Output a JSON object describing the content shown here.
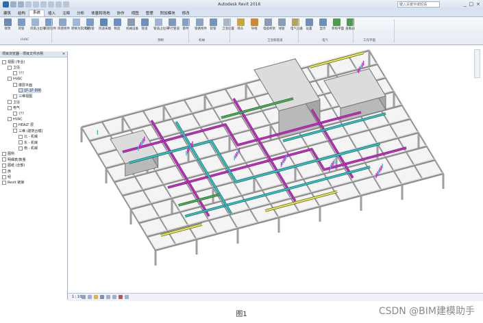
{
  "window": {
    "title": "Autodesk Revit 2016",
    "search_placeholder": "键入关键字或短语"
  },
  "ribbon_tabs": [
    "建筑",
    "结构",
    "系统",
    "插入",
    "注释",
    "分析",
    "体量和场地",
    "协作",
    "视图",
    "管理",
    "附加模块",
    "修改"
  ],
  "active_tab": "系统",
  "ribbon_panels": [
    "HVAC",
    "预制",
    "机械",
    "卫浴和管道",
    "电气",
    "工作平面"
  ],
  "ribbon_tools": [
    {
      "label": "修改",
      "icon": "modify-icon",
      "color": "#6d8ab5"
    },
    {
      "label": "风管",
      "icon": "duct-icon",
      "color": "#7a9cc6"
    },
    {
      "label": "风管占位符",
      "icon": "duct-placeholder-icon",
      "color": "#9db6d6"
    },
    {
      "label": "风管管件",
      "icon": "duct-fitting-icon",
      "color": "#7a9cc6"
    },
    {
      "label": "风管附件",
      "icon": "duct-accessory-icon",
      "color": "#8aa6cc"
    },
    {
      "label": "转换为软风管",
      "icon": "flex-convert-icon",
      "color": "#a0b8d8"
    },
    {
      "label": "软风管",
      "icon": "flex-duct-icon",
      "color": "#7a9cc6"
    },
    {
      "label": "风道末端",
      "icon": "air-terminal-icon",
      "color": "#5f86b8"
    },
    {
      "label": "制造",
      "icon": "fabrication-icon",
      "color": "#6b90c0"
    },
    {
      "label": "机械设备",
      "icon": "mechanical-equipment-icon",
      "color": "#889ab4"
    },
    {
      "label": "管道",
      "icon": "pipe-icon",
      "color": "#6e8fb9"
    },
    {
      "label": "管道占位符",
      "icon": "pipe-placeholder-icon",
      "color": "#9fb4d1"
    },
    {
      "label": "平行管道",
      "icon": "parallel-pipe-icon",
      "color": "#7c99bf"
    },
    {
      "label": "管件",
      "icon": "pipe-fitting-icon",
      "color": "#86a0c4"
    },
    {
      "label": "管路附件",
      "icon": "pipe-accessory-icon",
      "color": "#8aa2c3"
    },
    {
      "label": "软管",
      "icon": "flex-pipe-icon",
      "color": "#7893b9"
    },
    {
      "label": "卫浴装置",
      "icon": "plumbing-fixture-icon",
      "color": "#a9b6c8"
    },
    {
      "label": "喷头",
      "icon": "sprinkler-icon",
      "color": "#c8a640"
    },
    {
      "label": "导线",
      "icon": "wire-icon",
      "color": "#d08a2e"
    },
    {
      "label": "电缆桥架",
      "icon": "cable-tray-icon",
      "color": "#8a9cb6"
    },
    {
      "label": "线管",
      "icon": "conduit-icon",
      "color": "#8a9cb6"
    },
    {
      "label": "电气设备",
      "icon": "electrical-equipment-icon",
      "color": "#b7a25a"
    },
    {
      "label": "设置",
      "icon": "set-icon",
      "color": "#6f8fb8"
    },
    {
      "label": "显示",
      "icon": "show-icon",
      "color": "#6f8fb8"
    },
    {
      "label": "参照平面",
      "icon": "ref-plane-icon",
      "color": "#4f9a4f"
    },
    {
      "label": "查看器",
      "icon": "viewer-icon",
      "color": "#4f9a4f"
    }
  ],
  "browser": {
    "title": "项目浏览器 - 项目文件示例",
    "items": [
      {
        "label": "视图 (专业)",
        "level": 0,
        "expanded": true
      },
      {
        "label": "卫浴",
        "level": 1,
        "expanded": true
      },
      {
        "label": "???",
        "level": 2
      },
      {
        "label": "HVAC",
        "level": 1,
        "expanded": true
      },
      {
        "label": "楼层平面",
        "level": 2,
        "expanded": true
      },
      {
        "label": "1F-1F 000",
        "level": 3,
        "selected": true
      },
      {
        "label": "三维视图",
        "level": 2
      },
      {
        "label": "卫浴",
        "level": 1
      },
      {
        "label": "电气",
        "level": 1,
        "expanded": true
      },
      {
        "label": "???",
        "level": 2
      },
      {
        "label": "HVAC",
        "level": 1,
        "expanded": true
      },
      {
        "label": "HEALT 层",
        "level": 2
      },
      {
        "label": "三维 (建筑合模)",
        "level": 2,
        "expanded": true
      },
      {
        "label": "北 - 机械",
        "level": 3
      },
      {
        "label": "东 - 机械",
        "level": 3
      },
      {
        "label": "南 - 机械",
        "level": 3
      },
      {
        "label": "图例",
        "level": 0
      },
      {
        "label": "明细表/数量",
        "level": 0
      },
      {
        "label": "图纸 (全部)",
        "level": 0
      },
      {
        "label": "族",
        "level": 0
      },
      {
        "label": "组",
        "level": 0
      },
      {
        "label": "Revit 链接",
        "level": 0
      }
    ]
  },
  "statusbar": {
    "scale": "1 : 100"
  },
  "caption": "图1",
  "watermark": "CSDN @BIM建模助手"
}
